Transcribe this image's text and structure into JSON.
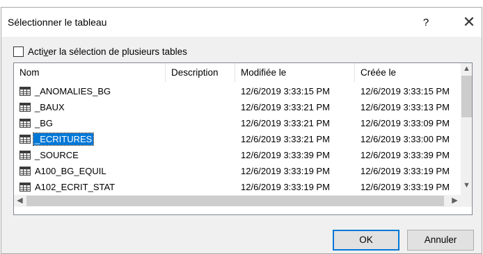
{
  "dialog": {
    "title": "Sélectionner le tableau",
    "help_label": "?",
    "close_label": "✕"
  },
  "multi_select": {
    "label_prefix": "Acti",
    "label_underlined": "v",
    "label_suffix": "er la sélection de plusieurs tables",
    "checked": false
  },
  "table": {
    "columns": [
      "Nom",
      "Description",
      "Modifiée le",
      "Créée le"
    ],
    "rows": [
      {
        "name": "_ANOMALIES_BG",
        "description": "",
        "modified": "12/6/2019 3:33:15 PM",
        "created": "12/6/2019 3:33:15 PM"
      },
      {
        "name": "_BAUX",
        "description": "",
        "modified": "12/6/2019 3:33:21 PM",
        "created": "12/6/2019 3:33:13 PM"
      },
      {
        "name": "_BG",
        "description": "",
        "modified": "12/6/2019 3:33:21 PM",
        "created": "12/6/2019 3:33:09 PM"
      },
      {
        "name": "_ECRITURES",
        "description": "",
        "modified": "12/6/2019 3:33:21 PM",
        "created": "12/6/2019 3:33:00 PM"
      },
      {
        "name": "_SOURCE",
        "description": "",
        "modified": "12/6/2019 3:33:39 PM",
        "created": "12/6/2019 3:33:39 PM"
      },
      {
        "name": "A100_BG_EQUIL",
        "description": "",
        "modified": "12/6/2019 3:33:19 PM",
        "created": "12/6/2019 3:33:19 PM"
      },
      {
        "name": "A102_ECRIT_STAT",
        "description": "",
        "modified": "12/6/2019 3:33:19 PM",
        "created": "12/6/2019 3:33:19 PM"
      }
    ],
    "selected_index": 3
  },
  "scroll_icons": {
    "up": "▲",
    "down": "▼",
    "left": "◀",
    "right": "▶"
  },
  "buttons": {
    "ok": "OK",
    "cancel": "Annuler"
  }
}
